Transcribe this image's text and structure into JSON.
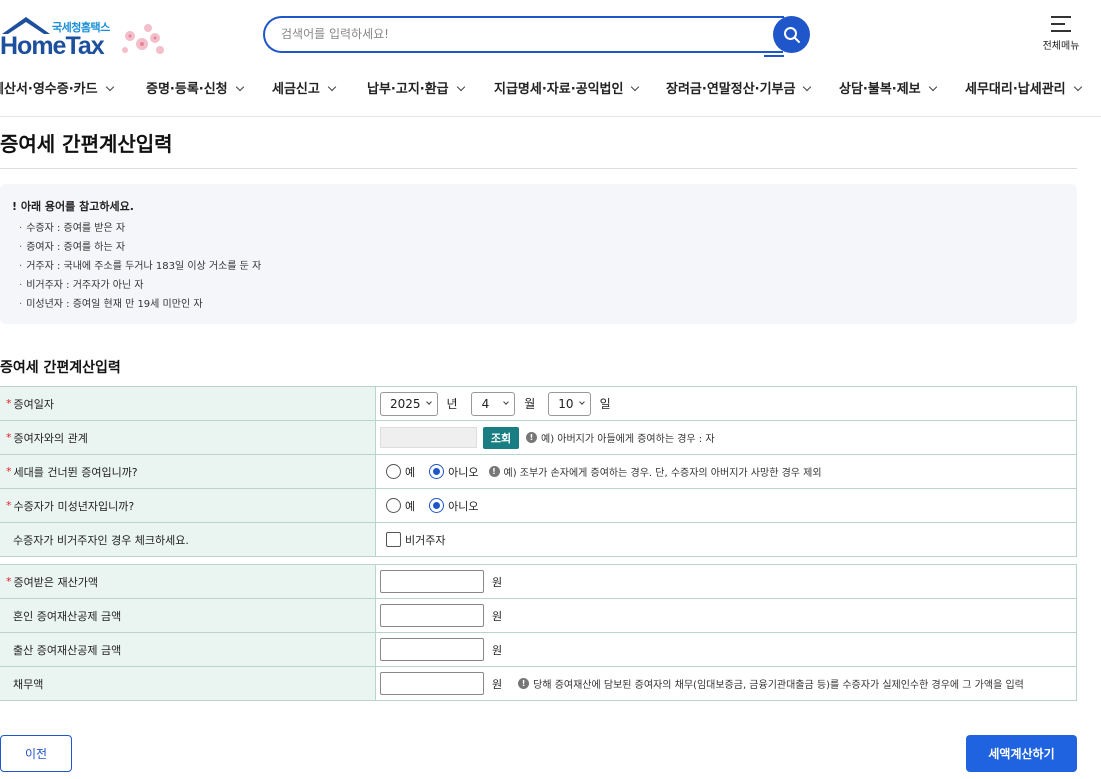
{
  "logo": {
    "sub": "국세청홈택스",
    "main": "HomeTax"
  },
  "search": {
    "placeholder": "검색어를 입력하세요!"
  },
  "allmenu": {
    "label": "전체메뉴"
  },
  "nav": [
    "계산서·영수증·카드",
    "증명·등록·신청",
    "세금신고",
    "납부·고지·환급",
    "지급명세·자료·공익법인",
    "장려금·연말정산·기부금",
    "상담·불복·제보",
    "세무대리·납세관리"
  ],
  "page_title": "증여세 간편계산입력",
  "notice": {
    "head": "! 아래 용어를 참고하세요.",
    "terms": [
      "수증자 : 증여를 받은 자",
      "증여자 : 증여를 하는 자",
      "거주자 : 국내에 주소를 두거나 183일 이상 거소를 둔 자",
      "비거주자 : 거주자가 아닌 자",
      "미성년자 : 증여일 현재 만 19세 미만인 자"
    ]
  },
  "section_title": "증여세 간편계산입력",
  "form": {
    "req_mark": "*",
    "gift_date": {
      "label": "증여일자",
      "year": "2025",
      "year_unit": "년",
      "month": "4",
      "month_unit": "월",
      "day": "10",
      "day_unit": "일"
    },
    "relation": {
      "label": "증여자와의 관계",
      "lookup": "조회",
      "hint": "예) 아버지가 아들에게 증여하는 경우 : 자"
    },
    "generation_skip": {
      "label": "세대를 건너뛴 증여입니까?",
      "yes": "예",
      "no": "아니오",
      "selected": "no",
      "hint": "예) 조부가 손자에게 증여하는 경우. 단, 수증자의 아버지가 사망한 경우 제외"
    },
    "minor": {
      "label": "수증자가 미성년자입니까?",
      "yes": "예",
      "no": "아니오",
      "selected": "no"
    },
    "nonresident": {
      "label": "수증자가 비거주자인 경우 체크하세요.",
      "check": "비거주자",
      "checked": false
    },
    "property_value": {
      "label": "증여받은 재산가액",
      "unit": "원"
    },
    "marriage_deduction": {
      "label": "혼인 증여재산공제 금액",
      "unit": "원"
    },
    "birth_deduction": {
      "label": "출산 증여재산공제 금액",
      "unit": "원"
    },
    "debt": {
      "label": "채무액",
      "unit": "원",
      "hint": "당해 증여재산에 담보된 증여자의 채무(임대보증금, 금융기관대출금 등)를 수증자가 실제인수한 경우에 그 가액을 입력"
    }
  },
  "buttons": {
    "prev": "이전",
    "calc": "세액계산하기"
  },
  "colors": {
    "primary": "#1f56c9",
    "lookup": "#187e83",
    "label_bg": "#eaf5f2",
    "required": "#e0202a"
  }
}
